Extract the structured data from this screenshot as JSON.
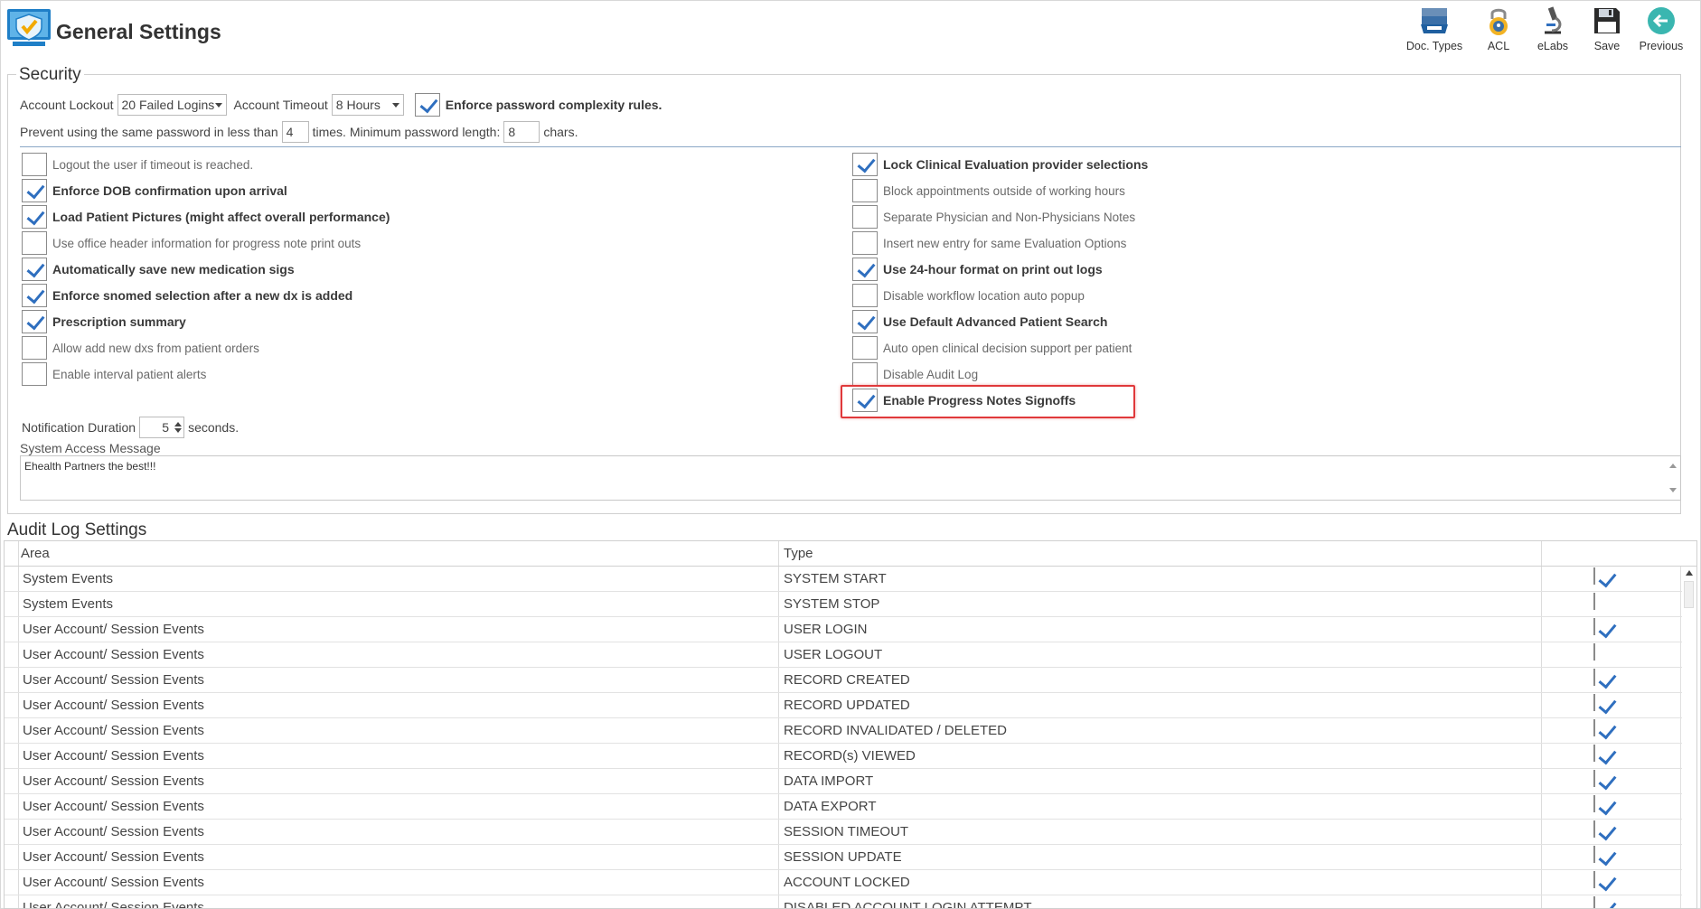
{
  "header": {
    "title": "General Settings",
    "toolbar": [
      {
        "label": "Doc. Types",
        "icon": "doc-types-icon"
      },
      {
        "label": "ACL",
        "icon": "lock-icon"
      },
      {
        "label": "eLabs",
        "icon": "microscope-icon"
      },
      {
        "label": "Save",
        "icon": "save-icon"
      },
      {
        "label": "Previous",
        "icon": "back-arrow-icon"
      }
    ]
  },
  "security": {
    "legend": "Security",
    "account_lockout_label": "Account Lockout",
    "account_lockout_value": "20 Failed Logins",
    "account_timeout_label": "Account Timeout",
    "account_timeout_value": "8 Hours",
    "enforce_complexity_label": "Enforce password complexity rules.",
    "enforce_complexity_checked": true,
    "prevent_label": "Prevent using the same password in less than",
    "prevent_value": "4",
    "times_label": "times. Minimum password length:",
    "min_length_value": "8",
    "chars_label": "chars.",
    "left_options": [
      {
        "label": "Logout the user if timeout is reached.",
        "checked": false
      },
      {
        "label": "Enforce DOB confirmation upon arrival",
        "checked": true
      },
      {
        "label": "Load Patient Pictures (might affect overall performance)",
        "checked": true
      },
      {
        "label": "Use office header information for progress note print outs",
        "checked": false
      },
      {
        "label": "Automatically save new medication sigs",
        "checked": true
      },
      {
        "label": "Enforce snomed selection after a new dx is added",
        "checked": true
      },
      {
        "label": "Prescription summary",
        "checked": true
      },
      {
        "label": "Allow add new dxs from patient orders",
        "checked": false
      },
      {
        "label": "Enable interval patient alerts",
        "checked": false
      }
    ],
    "right_options": [
      {
        "label": "Lock Clinical Evaluation provider selections",
        "checked": true
      },
      {
        "label": "Block appointments outside of working hours",
        "checked": false
      },
      {
        "label": "Separate Physician and Non-Physicians Notes",
        "checked": false
      },
      {
        "label": "Insert new entry for same Evaluation Options",
        "checked": false
      },
      {
        "label": "Use 24-hour format on print out logs",
        "checked": true
      },
      {
        "label": "Disable workflow location auto popup",
        "checked": false
      },
      {
        "label": "Use Default Advanced Patient Search",
        "checked": true
      },
      {
        "label": "Auto open clinical decision support per patient",
        "checked": false
      },
      {
        "label": "Disable Audit Log",
        "checked": false
      },
      {
        "label": "Enable Progress Notes Signoffs",
        "checked": true
      }
    ],
    "notification_label": "Notification Duration",
    "notification_value": "5",
    "seconds_label": "seconds.",
    "system_access_label": "System Access Message",
    "system_access_value": "Ehealth Partners the best!!!"
  },
  "audit": {
    "title": "Audit Log Settings",
    "columns": [
      "Area",
      "Type"
    ],
    "rows": [
      {
        "area": "System Events",
        "type": "SYSTEM START",
        "checked": true
      },
      {
        "area": "System Events",
        "type": "SYSTEM STOP",
        "checked": false
      },
      {
        "area": "User Account/ Session Events",
        "type": "USER LOGIN",
        "checked": true
      },
      {
        "area": "User Account/ Session Events",
        "type": "USER LOGOUT",
        "checked": false
      },
      {
        "area": "User Account/ Session Events",
        "type": "RECORD CREATED",
        "checked": true
      },
      {
        "area": "User Account/ Session Events",
        "type": "RECORD UPDATED",
        "checked": true
      },
      {
        "area": "User Account/ Session Events",
        "type": "RECORD INVALIDATED / DELETED",
        "checked": true
      },
      {
        "area": "User Account/ Session Events",
        "type": "RECORD(s) VIEWED",
        "checked": true
      },
      {
        "area": "User Account/ Session Events",
        "type": "DATA IMPORT",
        "checked": true
      },
      {
        "area": "User Account/ Session Events",
        "type": "DATA EXPORT",
        "checked": true
      },
      {
        "area": "User Account/ Session Events",
        "type": "SESSION TIMEOUT",
        "checked": true
      },
      {
        "area": "User Account/ Session Events",
        "type": "SESSION UPDATE",
        "checked": true
      },
      {
        "area": "User Account/ Session Events",
        "type": "ACCOUNT LOCKED",
        "checked": true
      },
      {
        "area": "User Account/ Session Events",
        "type": "DISABLED ACCOUNT LOGIN ATTEMPT",
        "checked": true
      }
    ]
  },
  "colors": {
    "accent": "#2f6fbf",
    "highlight": "#e0393b"
  }
}
